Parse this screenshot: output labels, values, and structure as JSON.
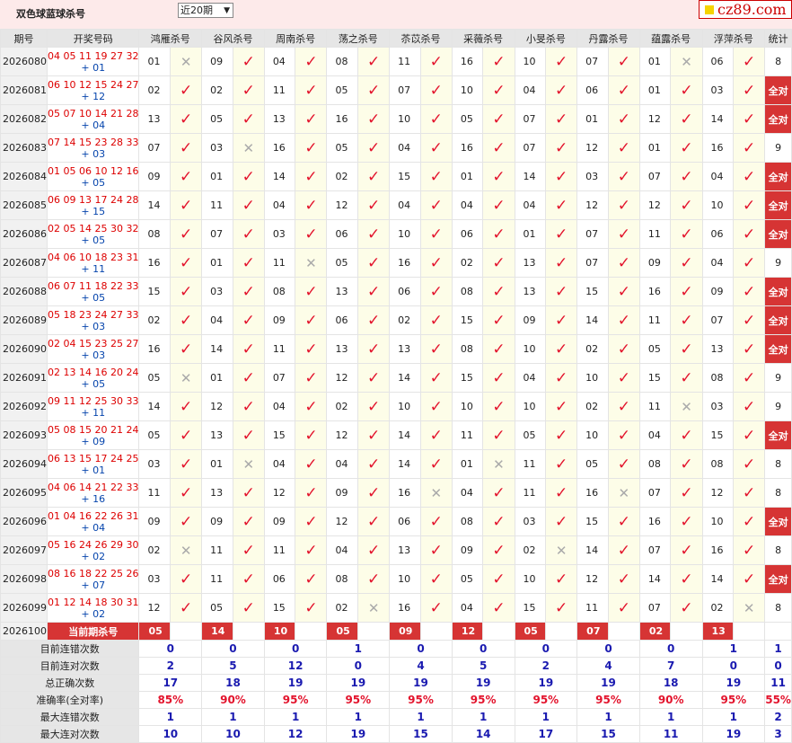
{
  "header": {
    "title": "双色球蓝球杀号",
    "period_select": "近20期",
    "logo": "cz89.com"
  },
  "columns": [
    "期号",
    "开奖号码",
    "鸿雁杀号",
    "谷风杀号",
    "周南杀号",
    "荡之杀号",
    "苶苡杀号",
    "采薇杀号",
    "小旻杀号",
    "丹露杀号",
    "蕴露杀号",
    "浮萍杀号",
    "统计"
  ],
  "rows": [
    {
      "issue": "2026080",
      "red": "04 05 11 19 27 32",
      "blue": "+ 01",
      "kills": [
        "01",
        "09",
        "04",
        "08",
        "11",
        "16",
        "10",
        "07",
        "01",
        "06"
      ],
      "hits": [
        0,
        1,
        1,
        1,
        1,
        1,
        1,
        1,
        0,
        1
      ],
      "stat": "8"
    },
    {
      "issue": "2026081",
      "red": "06 10 12 15 24 27",
      "blue": "+ 12",
      "kills": [
        "02",
        "02",
        "11",
        "05",
        "07",
        "10",
        "04",
        "06",
        "01",
        "03"
      ],
      "hits": [
        1,
        1,
        1,
        1,
        1,
        1,
        1,
        1,
        1,
        1
      ],
      "stat": "全对"
    },
    {
      "issue": "2026082",
      "red": "05 07 10 14 21 28",
      "blue": "+ 04",
      "kills": [
        "13",
        "05",
        "13",
        "16",
        "10",
        "05",
        "07",
        "01",
        "12",
        "14"
      ],
      "hits": [
        1,
        1,
        1,
        1,
        1,
        1,
        1,
        1,
        1,
        1
      ],
      "stat": "全对"
    },
    {
      "issue": "2026083",
      "red": "07 14 15 23 28 33",
      "blue": "+ 03",
      "kills": [
        "07",
        "03",
        "16",
        "05",
        "04",
        "16",
        "07",
        "12",
        "01",
        "16"
      ],
      "hits": [
        1,
        0,
        1,
        1,
        1,
        1,
        1,
        1,
        1,
        1
      ],
      "stat": "9"
    },
    {
      "issue": "2026084",
      "red": "01 05 06 10 12 16",
      "blue": "+ 05",
      "kills": [
        "09",
        "01",
        "14",
        "02",
        "15",
        "01",
        "14",
        "03",
        "07",
        "04"
      ],
      "hits": [
        1,
        1,
        1,
        1,
        1,
        1,
        1,
        1,
        1,
        1
      ],
      "stat": "全对"
    },
    {
      "issue": "2026085",
      "red": "06 09 13 17 24 28",
      "blue": "+ 15",
      "kills": [
        "14",
        "11",
        "04",
        "12",
        "04",
        "04",
        "04",
        "12",
        "12",
        "10"
      ],
      "hits": [
        1,
        1,
        1,
        1,
        1,
        1,
        1,
        1,
        1,
        1
      ],
      "stat": "全对"
    },
    {
      "issue": "2026086",
      "red": "02 05 14 25 30 32",
      "blue": "+ 05",
      "kills": [
        "08",
        "07",
        "03",
        "06",
        "10",
        "06",
        "01",
        "07",
        "11",
        "06"
      ],
      "hits": [
        1,
        1,
        1,
        1,
        1,
        1,
        1,
        1,
        1,
        1
      ],
      "stat": "全对"
    },
    {
      "issue": "2026087",
      "red": "04 06 10 18 23 31",
      "blue": "+ 11",
      "kills": [
        "16",
        "01",
        "11",
        "05",
        "16",
        "02",
        "13",
        "07",
        "09",
        "04"
      ],
      "hits": [
        1,
        1,
        0,
        1,
        1,
        1,
        1,
        1,
        1,
        1
      ],
      "stat": "9"
    },
    {
      "issue": "2026088",
      "red": "06 07 11 18 22 33",
      "blue": "+ 05",
      "kills": [
        "15",
        "03",
        "08",
        "13",
        "06",
        "08",
        "13",
        "15",
        "16",
        "09"
      ],
      "hits": [
        1,
        1,
        1,
        1,
        1,
        1,
        1,
        1,
        1,
        1
      ],
      "stat": "全对"
    },
    {
      "issue": "2026089",
      "red": "05 18 23 24 27 33",
      "blue": "+ 03",
      "kills": [
        "02",
        "04",
        "09",
        "06",
        "02",
        "15",
        "09",
        "14",
        "11",
        "07"
      ],
      "hits": [
        1,
        1,
        1,
        1,
        1,
        1,
        1,
        1,
        1,
        1
      ],
      "stat": "全对"
    },
    {
      "issue": "2026090",
      "red": "02 04 15 23 25 27",
      "blue": "+ 03",
      "kills": [
        "16",
        "14",
        "11",
        "13",
        "13",
        "08",
        "10",
        "02",
        "05",
        "13"
      ],
      "hits": [
        1,
        1,
        1,
        1,
        1,
        1,
        1,
        1,
        1,
        1
      ],
      "stat": "全对"
    },
    {
      "issue": "2026091",
      "red": "02 13 14 16 20 24",
      "blue": "+ 05",
      "kills": [
        "05",
        "01",
        "07",
        "12",
        "14",
        "15",
        "04",
        "10",
        "15",
        "08"
      ],
      "hits": [
        0,
        1,
        1,
        1,
        1,
        1,
        1,
        1,
        1,
        1
      ],
      "stat": "9"
    },
    {
      "issue": "2026092",
      "red": "09 11 12 25 30 33",
      "blue": "+ 11",
      "kills": [
        "14",
        "12",
        "04",
        "02",
        "10",
        "10",
        "10",
        "02",
        "11",
        "03"
      ],
      "hits": [
        1,
        1,
        1,
        1,
        1,
        1,
        1,
        1,
        0,
        1
      ],
      "stat": "9"
    },
    {
      "issue": "2026093",
      "red": "05 08 15 20 21 24",
      "blue": "+ 09",
      "kills": [
        "05",
        "13",
        "15",
        "12",
        "14",
        "11",
        "05",
        "10",
        "04",
        "15"
      ],
      "hits": [
        1,
        1,
        1,
        1,
        1,
        1,
        1,
        1,
        1,
        1
      ],
      "stat": "全对"
    },
    {
      "issue": "2026094",
      "red": "06 13 15 17 24 25",
      "blue": "+ 01",
      "kills": [
        "03",
        "01",
        "04",
        "04",
        "14",
        "01",
        "11",
        "05",
        "08",
        "08"
      ],
      "hits": [
        1,
        0,
        1,
        1,
        1,
        0,
        1,
        1,
        1,
        1
      ],
      "stat": "8"
    },
    {
      "issue": "2026095",
      "red": "04 06 14 21 22 33",
      "blue": "+ 16",
      "kills": [
        "11",
        "13",
        "12",
        "09",
        "16",
        "04",
        "11",
        "16",
        "07",
        "12"
      ],
      "hits": [
        1,
        1,
        1,
        1,
        0,
        1,
        1,
        0,
        1,
        1
      ],
      "stat": "8"
    },
    {
      "issue": "2026096",
      "red": "01 04 16 22 26 31",
      "blue": "+ 04",
      "kills": [
        "09",
        "09",
        "09",
        "12",
        "06",
        "08",
        "03",
        "15",
        "16",
        "10"
      ],
      "hits": [
        1,
        1,
        1,
        1,
        1,
        1,
        1,
        1,
        1,
        1
      ],
      "stat": "全对"
    },
    {
      "issue": "2026097",
      "red": "05 16 24 26 29 30",
      "blue": "+ 02",
      "kills": [
        "02",
        "11",
        "11",
        "04",
        "13",
        "09",
        "02",
        "14",
        "07",
        "16"
      ],
      "hits": [
        0,
        1,
        1,
        1,
        1,
        1,
        0,
        1,
        1,
        1
      ],
      "stat": "8"
    },
    {
      "issue": "2026098",
      "red": "08 16 18 22 25 26",
      "blue": "+ 07",
      "kills": [
        "03",
        "11",
        "06",
        "08",
        "10",
        "05",
        "10",
        "12",
        "14",
        "14"
      ],
      "hits": [
        1,
        1,
        1,
        1,
        1,
        1,
        1,
        1,
        1,
        1
      ],
      "stat": "全对"
    },
    {
      "issue": "2026099",
      "red": "01 12 14 18 30 31",
      "blue": "+ 02",
      "kills": [
        "12",
        "05",
        "15",
        "02",
        "16",
        "04",
        "15",
        "11",
        "07",
        "02"
      ],
      "hits": [
        1,
        1,
        1,
        0,
        1,
        1,
        1,
        1,
        1,
        0
      ],
      "stat": "8"
    }
  ],
  "current": {
    "issue": "2026100",
    "label": "当前期杀号",
    "kills": [
      "05",
      "14",
      "10",
      "05",
      "09",
      "12",
      "05",
      "07",
      "02",
      "13"
    ]
  },
  "summary": [
    {
      "label": "目前连错次数",
      "values": [
        "0",
        "0",
        "0",
        "1",
        "0",
        "0",
        "0",
        "0",
        "0",
        "1",
        "1"
      ]
    },
    {
      "label": "目前连对次数",
      "values": [
        "2",
        "5",
        "12",
        "0",
        "4",
        "5",
        "2",
        "4",
        "7",
        "0",
        "0"
      ]
    },
    {
      "label": "总正确次数",
      "values": [
        "17",
        "18",
        "19",
        "19",
        "19",
        "19",
        "19",
        "19",
        "18",
        "19",
        "11"
      ]
    },
    {
      "label": "准确率(全对率)",
      "values": [
        "85%",
        "90%",
        "95%",
        "95%",
        "95%",
        "95%",
        "95%",
        "95%",
        "90%",
        "95%",
        "55%"
      ],
      "pct": true
    },
    {
      "label": "最大连错次数",
      "values": [
        "1",
        "1",
        "1",
        "1",
        "1",
        "1",
        "1",
        "1",
        "1",
        "1",
        "2"
      ]
    },
    {
      "label": "最大连对次数",
      "values": [
        "10",
        "10",
        "12",
        "19",
        "15",
        "14",
        "17",
        "15",
        "11",
        "19",
        "3"
      ]
    }
  ],
  "icons": {
    "hit": "check-icon",
    "miss": "cross-icon"
  },
  "colors": {
    "hit": "#e3132c",
    "miss": "#aaaaaa",
    "all_correct_bg": "#d63434",
    "summary_value": "#1a1ab0"
  }
}
